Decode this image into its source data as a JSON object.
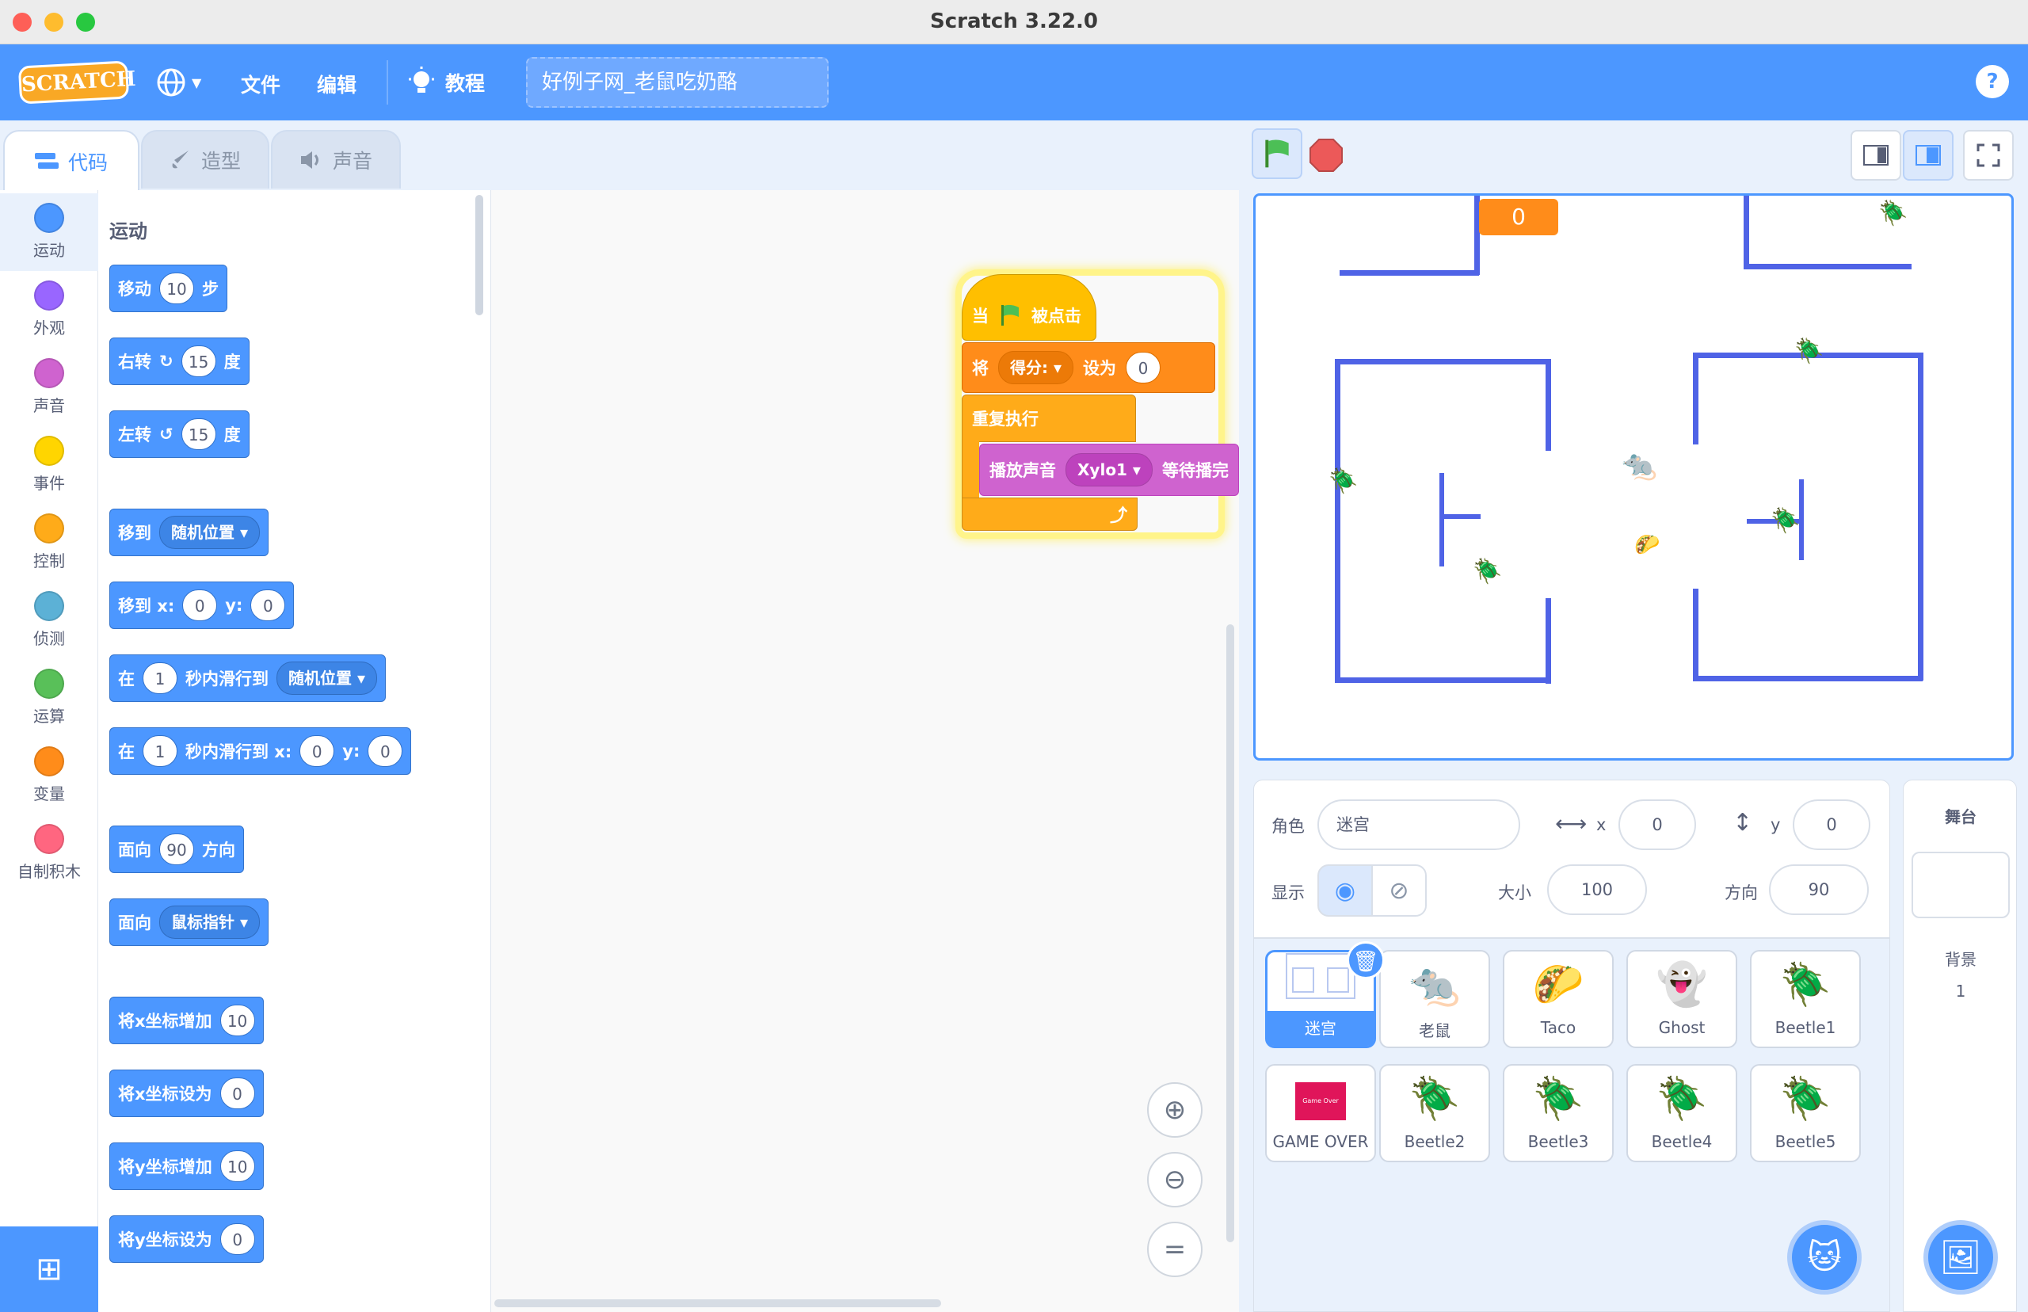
{
  "window": {
    "title": "Scratch 3.22.0"
  },
  "menu": {
    "logo": "SCRATCH",
    "file": "文件",
    "edit": "编辑",
    "tutorials": "教程",
    "project_title": "好例子网_老鼠吃奶酪",
    "help": "?"
  },
  "tabs": {
    "code": "代码",
    "costumes": "造型",
    "sounds": "声音"
  },
  "categories": [
    {
      "label": "运动",
      "color": "#4c97ff"
    },
    {
      "label": "外观",
      "color": "#9966ff"
    },
    {
      "label": "声音",
      "color": "#cf63cf"
    },
    {
      "label": "事件",
      "color": "#ffd500"
    },
    {
      "label": "控制",
      "color": "#ffab19"
    },
    {
      "label": "侦测",
      "color": "#5cb1d6"
    },
    {
      "label": "运算",
      "color": "#59c059"
    },
    {
      "label": "变量",
      "color": "#ff8c1a"
    },
    {
      "label": "自制积木",
      "color": "#ff6680"
    }
  ],
  "palette": {
    "section": "运动",
    "move": {
      "a": "移动",
      "v": "10",
      "b": "步"
    },
    "turn_right": {
      "a": "右转",
      "v": "15",
      "b": "度"
    },
    "turn_left": {
      "a": "左转",
      "v": "15",
      "b": "度"
    },
    "goto": {
      "a": "移到",
      "d": "随机位置"
    },
    "goto_xy": {
      "a": "移到 x:",
      "x": "0",
      "y_label": "y:",
      "y": "0"
    },
    "glide": {
      "a": "在",
      "v": "1",
      "b": "秒内滑行到",
      "d": "随机位置"
    },
    "glide_xy": {
      "a": "在",
      "v": "1",
      "b": "秒内滑行到 x:",
      "x": "0",
      "y_label": "y:",
      "y": "0"
    },
    "point_dir": {
      "a": "面向",
      "v": "90",
      "b": "方向"
    },
    "point_towards": {
      "a": "面向",
      "d": "鼠标指针"
    },
    "change_x": {
      "a": "将x坐标增加",
      "v": "10"
    },
    "set_x": {
      "a": "将x坐标设为",
      "v": "0"
    },
    "change_y": {
      "a": "将y坐标增加",
      "v": "10"
    },
    "set_y": {
      "a": "将y坐标设为",
      "v": "0"
    }
  },
  "script": {
    "hat_a": "当",
    "hat_b": "被点击",
    "set_a": "将",
    "set_var": "得分:",
    "set_b": "设为",
    "set_v": "0",
    "forever": "重复执行",
    "sound_a": "播放声音",
    "sound_d": "Xylo1",
    "sound_b": "等待播完"
  },
  "stage": {
    "score": "0"
  },
  "sprite_info": {
    "sprite_label": "角色",
    "sprite_name": "迷宫",
    "x_label": "x",
    "x": "0",
    "y_label": "y",
    "y": "0",
    "show_label": "显示",
    "size_label": "大小",
    "size": "100",
    "direction_label": "方向",
    "direction": "90"
  },
  "sprites": [
    {
      "name": "迷宫",
      "icon": "maze-thumbnail"
    },
    {
      "name": "老鼠",
      "icon": "mouse"
    },
    {
      "name": "Taco",
      "icon": "taco"
    },
    {
      "name": "Ghost",
      "icon": "ghost"
    },
    {
      "name": "Beetle1",
      "icon": "beetle"
    },
    {
      "name": "GAME OVER",
      "icon": "game-over-card",
      "thumb_text": "Game Over"
    },
    {
      "name": "Beetle2",
      "icon": "beetle"
    },
    {
      "name": "Beetle3",
      "icon": "beetle"
    },
    {
      "name": "Beetle4",
      "icon": "beetle"
    },
    {
      "name": "Beetle5",
      "icon": "beetle"
    }
  ],
  "stage_panel": {
    "title": "舞台",
    "backdrop_label": "背景",
    "backdrop_count": "1"
  }
}
